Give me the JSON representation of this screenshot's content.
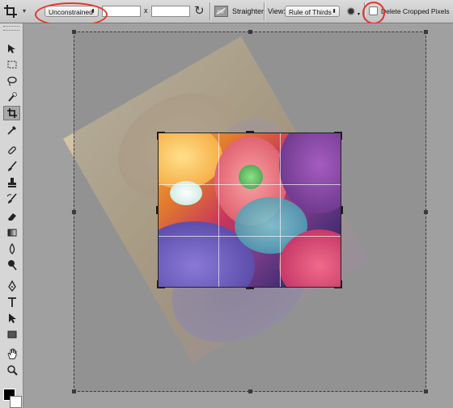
{
  "options_bar": {
    "preset_arrow": "▾",
    "ratio_select": "Unconstrained",
    "ratio_arrow": "⬍",
    "width_value": "",
    "x_label": "x",
    "height_value": "",
    "swap_glyph": "↻",
    "straighten_label": "Straighten",
    "view_label": "View:",
    "view_select": "Rule of Thirds",
    "view_arrow": "⬍",
    "gear_glyph": "✹",
    "gear_arrow": "▾",
    "delete_cropped_label": "Delete Cropped Pixels",
    "delete_cropped_checked": false
  },
  "toolbar": {
    "tools": [
      {
        "name": "move-tool",
        "active": false
      },
      {
        "name": "rectangular-marquee-tool",
        "active": false
      },
      {
        "name": "lasso-tool",
        "active": false
      },
      {
        "name": "quick-selection-tool",
        "active": false
      },
      {
        "name": "crop-tool",
        "active": true
      },
      {
        "name": "eyedropper-tool",
        "active": false
      },
      {
        "name": "spot-healing-brush-tool",
        "active": false
      },
      {
        "name": "brush-tool",
        "active": false
      },
      {
        "name": "clone-stamp-tool",
        "active": false
      },
      {
        "name": "history-brush-tool",
        "active": false
      },
      {
        "name": "eraser-tool",
        "active": false
      },
      {
        "name": "gradient-tool",
        "active": false
      },
      {
        "name": "blur-tool",
        "active": false
      },
      {
        "name": "dodge-tool",
        "active": false
      },
      {
        "name": "pen-tool",
        "active": false
      },
      {
        "name": "type-tool",
        "active": false
      },
      {
        "name": "path-selection-tool",
        "active": false
      },
      {
        "name": "rectangle-tool",
        "active": false
      },
      {
        "name": "hand-tool",
        "active": false
      },
      {
        "name": "zoom-tool",
        "active": false
      }
    ],
    "foreground_color": "#000000",
    "background_color": "#ffffff"
  },
  "colors": {
    "annotation_red": "#e3352b",
    "canvas_gray": "#a0a0a0"
  }
}
